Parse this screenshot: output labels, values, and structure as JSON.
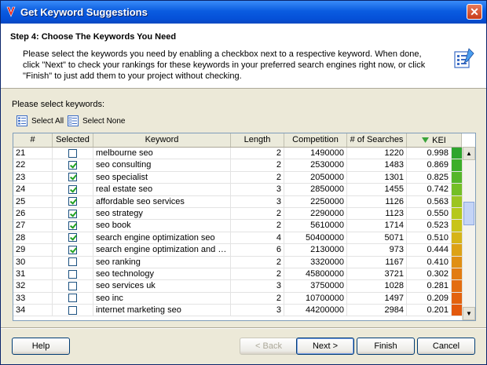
{
  "window": {
    "title": "Get Keyword Suggestions",
    "close_label": "✕"
  },
  "header": {
    "step_title": "Step 4: Choose The Keywords You Need",
    "description": "Please select the keywords you need by enabling a checkbox next to a respective keyword. When done, click \"Next\" to check your rankings for these keywords in your preferred search engines right now, or click \"Finish\" to just add them to your project without checking."
  },
  "select_label": "Please select keywords:",
  "toolbar": {
    "select_all": "Select All",
    "select_none": "Select None"
  },
  "grid": {
    "columns": [
      "#",
      "Selected",
      "Keyword",
      "Length",
      "Competition",
      "# of Searches",
      "KEI"
    ],
    "sort_column": "KEI",
    "rows": [
      {
        "num": "21",
        "selected": false,
        "keyword": "melbourne seo",
        "length": "2",
        "competition": "1490000",
        "searches": "1220",
        "kei": "0.998",
        "color": "#2da52d"
      },
      {
        "num": "22",
        "selected": true,
        "keyword": "seo consulting",
        "length": "2",
        "competition": "2530000",
        "searches": "1483",
        "kei": "0.869",
        "color": "#3cae2a"
      },
      {
        "num": "23",
        "selected": true,
        "keyword": "seo specialist",
        "length": "2",
        "competition": "2050000",
        "searches": "1301",
        "kei": "0.825",
        "color": "#55b62a"
      },
      {
        "num": "24",
        "selected": true,
        "keyword": "real estate seo",
        "length": "3",
        "competition": "2850000",
        "searches": "1455",
        "kei": "0.742",
        "color": "#74bf26"
      },
      {
        "num": "25",
        "selected": true,
        "keyword": "affordable seo services",
        "length": "3",
        "competition": "2250000",
        "searches": "1126",
        "kei": "0.563",
        "color": "#9cc521"
      },
      {
        "num": "26",
        "selected": true,
        "keyword": "seo strategy",
        "length": "2",
        "competition": "2290000",
        "searches": "1123",
        "kei": "0.550",
        "color": "#b5c81d"
      },
      {
        "num": "27",
        "selected": true,
        "keyword": "seo book",
        "length": "2",
        "competition": "5610000",
        "searches": "1714",
        "kei": "0.523",
        "color": "#c8c41a"
      },
      {
        "num": "28",
        "selected": true,
        "keyword": "search engine optimization seo",
        "length": "4",
        "competition": "50400000",
        "searches": "5071",
        "kei": "0.510",
        "color": "#d6b418"
      },
      {
        "num": "29",
        "selected": true,
        "keyword": "search engine optimization and se...",
        "length": "6",
        "competition": "2130000",
        "searches": "973",
        "kei": "0.444",
        "color": "#dda216"
      },
      {
        "num": "30",
        "selected": false,
        "keyword": "seo ranking",
        "length": "2",
        "competition": "3320000",
        "searches": "1167",
        "kei": "0.410",
        "color": "#e08f14"
      },
      {
        "num": "31",
        "selected": false,
        "keyword": "seo technology",
        "length": "2",
        "competition": "45800000",
        "searches": "3721",
        "kei": "0.302",
        "color": "#e27c12"
      },
      {
        "num": "32",
        "selected": false,
        "keyword": "seo services uk",
        "length": "3",
        "competition": "3750000",
        "searches": "1028",
        "kei": "0.281",
        "color": "#e36d10"
      },
      {
        "num": "33",
        "selected": false,
        "keyword": "seo inc",
        "length": "2",
        "competition": "10700000",
        "searches": "1497",
        "kei": "0.209",
        "color": "#e3620e"
      },
      {
        "num": "34",
        "selected": false,
        "keyword": "internet marketing seo",
        "length": "3",
        "competition": "44200000",
        "searches": "2984",
        "kei": "0.201",
        "color": "#e3590c"
      }
    ]
  },
  "buttons": {
    "help": "Help",
    "back": "< Back",
    "next": "Next >",
    "finish": "Finish",
    "cancel": "Cancel"
  }
}
